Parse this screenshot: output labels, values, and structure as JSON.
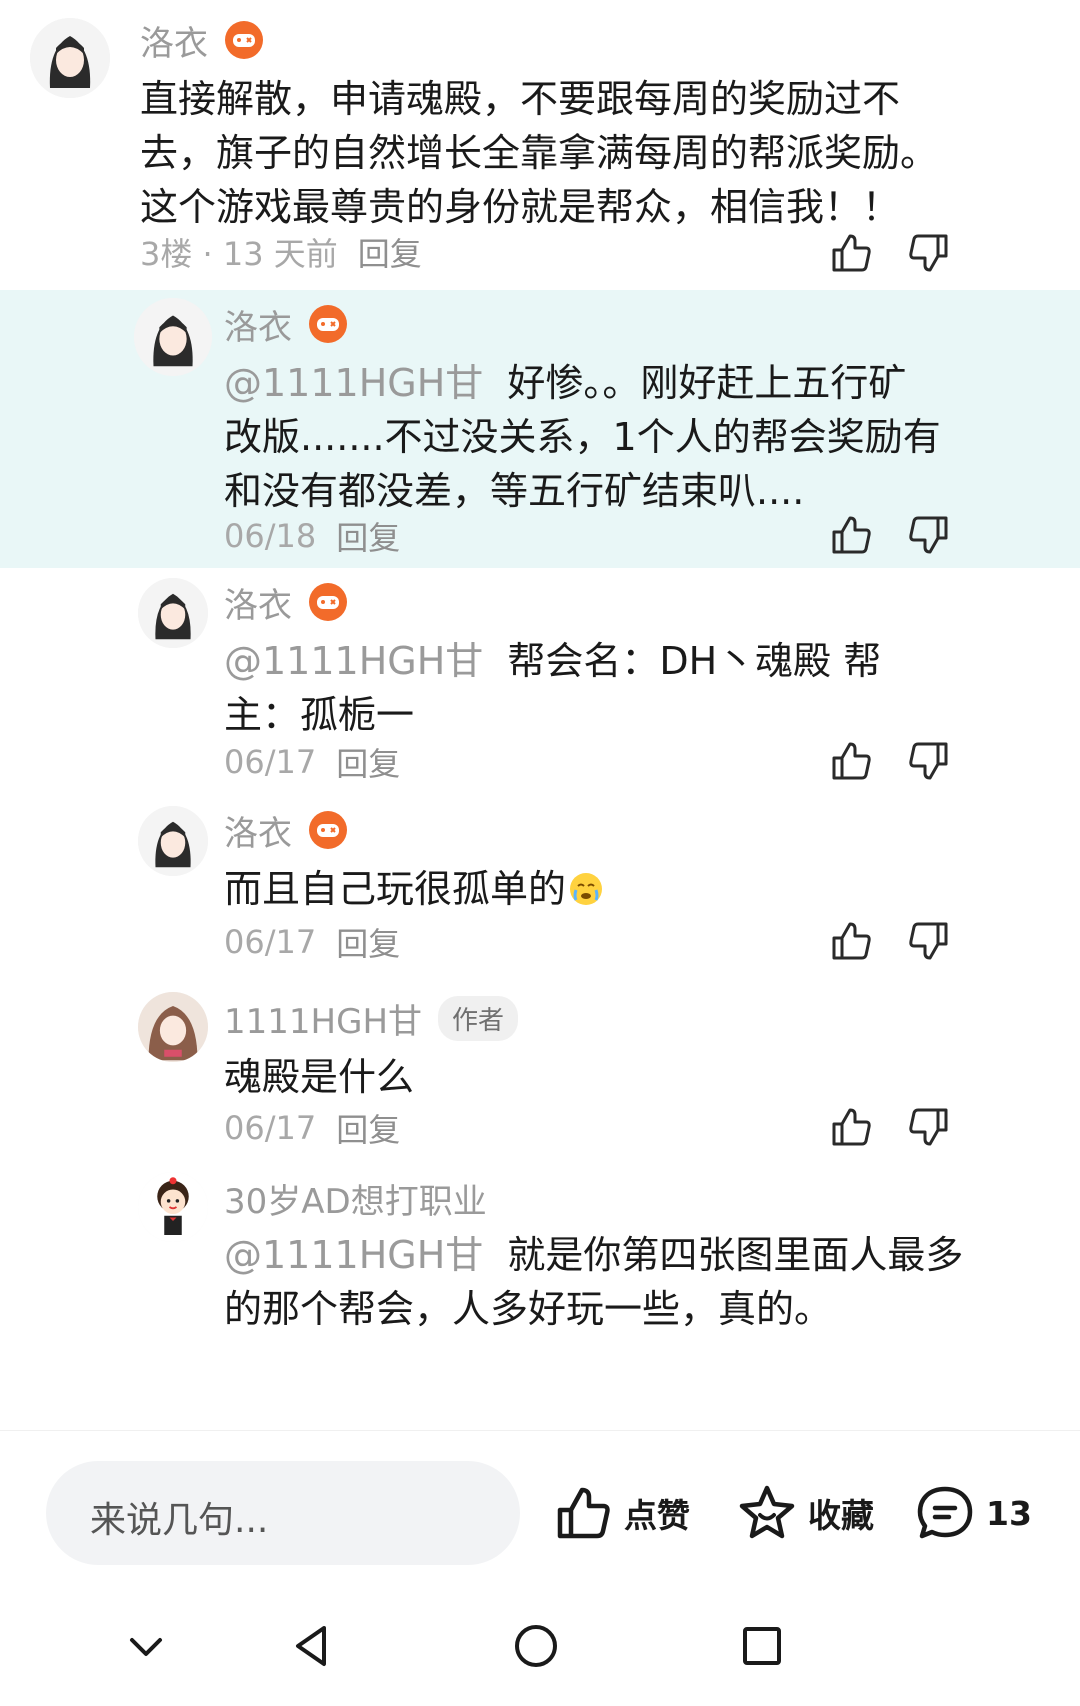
{
  "comments": [
    {
      "name": "洛衣",
      "text": "直接解散，申请魂殿，不要跟每周的奖励过不去，旗子的自然增长全靠拿满每周的帮派奖励。这个游戏最尊贵的身份就是帮众，相信我！！",
      "meta": "3楼 · 13 天前",
      "reply": "回复"
    },
    {
      "name": "洛衣",
      "mention": "@1111HGH甘",
      "text": "好惨。。刚好赶上五行矿改版.......不过没关系，1个人的帮会奖励有和没有都没差，等五行矿结束叭....",
      "meta": "06/18",
      "reply": "回复"
    },
    {
      "name": "洛衣",
      "mention": "@1111HGH甘",
      "text": "帮会名：DH丶魂殿 帮主：孤栀一",
      "meta": "06/17",
      "reply": "回复"
    },
    {
      "name": "洛衣",
      "text": "而且自己玩很孤单的",
      "meta": "06/17",
      "reply": "回复"
    },
    {
      "name": "1111HGH甘",
      "author_tag": "作者",
      "text": "魂殿是什么",
      "meta": "06/17",
      "reply": "回复"
    },
    {
      "name": "30岁AD想打职业",
      "mention": "@1111HGH甘",
      "text": "就是你第四张图里面人最多的那个帮会，人多好玩一些，真的。"
    }
  ],
  "bottom_bar": {
    "input_placeholder": "来说几句...",
    "like_label": "点赞",
    "favorite_label": "收藏",
    "comment_count": "13"
  },
  "colors": {
    "highlight_bg": "#e9f7f7",
    "badge_orange": "#f26b2a",
    "muted_text": "#9a9a9a"
  }
}
